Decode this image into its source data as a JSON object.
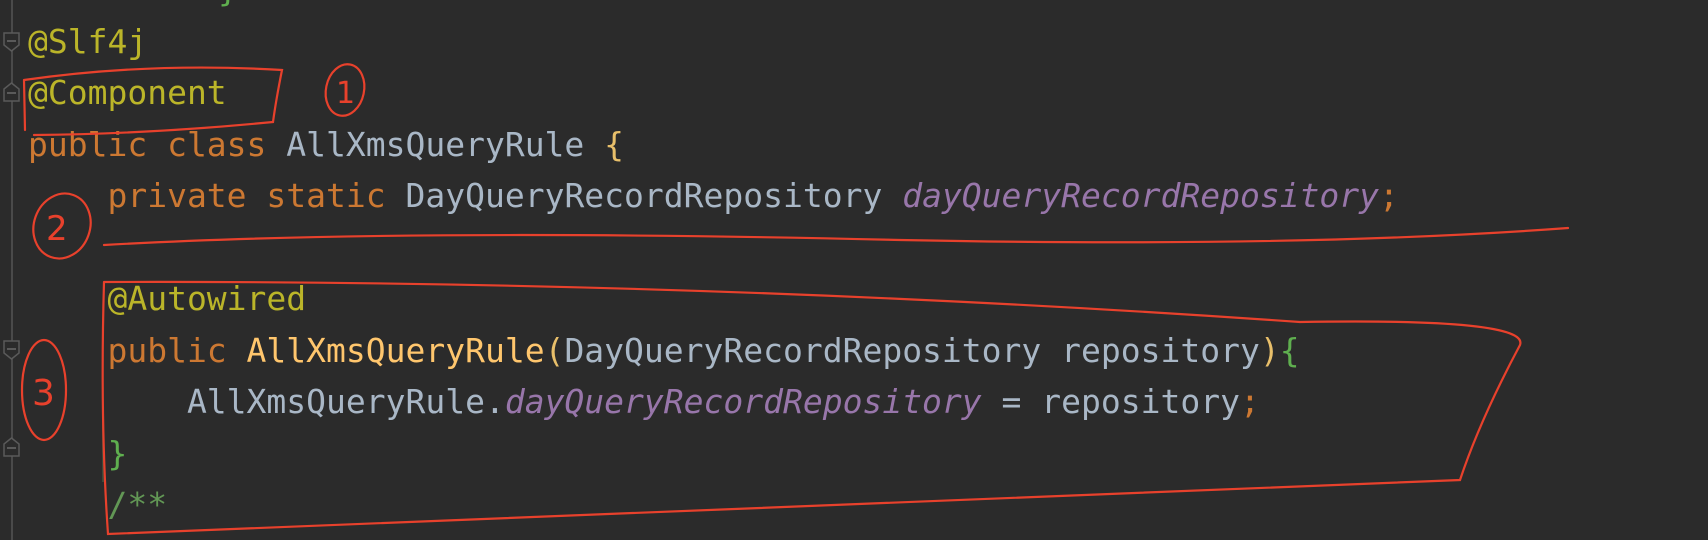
{
  "code_lines": {
    "l0": "}",
    "l1": "@Slf4j",
    "l2": "@Component",
    "l3_kw": "public class ",
    "l3_name": "AllXmsQueryRule ",
    "l3_brace": "{",
    "l4_kw": "    private static ",
    "l4_type": "DayQueryRecordRepository ",
    "l4_field": "dayQueryRecordRepository",
    "l4_semi": ";",
    "l6": "    @Autowired",
    "l7_kw": "    public ",
    "l7_name": "AllXmsQueryRule",
    "l7_paren_open": "(",
    "l7_params": "DayQueryRecordRepository repository",
    "l7_paren_close": ")",
    "l7_brace": "{",
    "l8_a": "        AllXmsQueryRule.",
    "l8_field": "dayQueryRecordRepository",
    "l8_b": " = repository",
    "l8_semi": ";",
    "l9": "    }",
    "l10": "    /**"
  },
  "annotations": {
    "n1": "1",
    "n2": "2",
    "n3": "3"
  },
  "colors": {
    "annotation": "#bbb529",
    "keyword": "#cc7832",
    "field": "#9876aa",
    "method": "#ffc66d",
    "markup": "#e8412c"
  }
}
